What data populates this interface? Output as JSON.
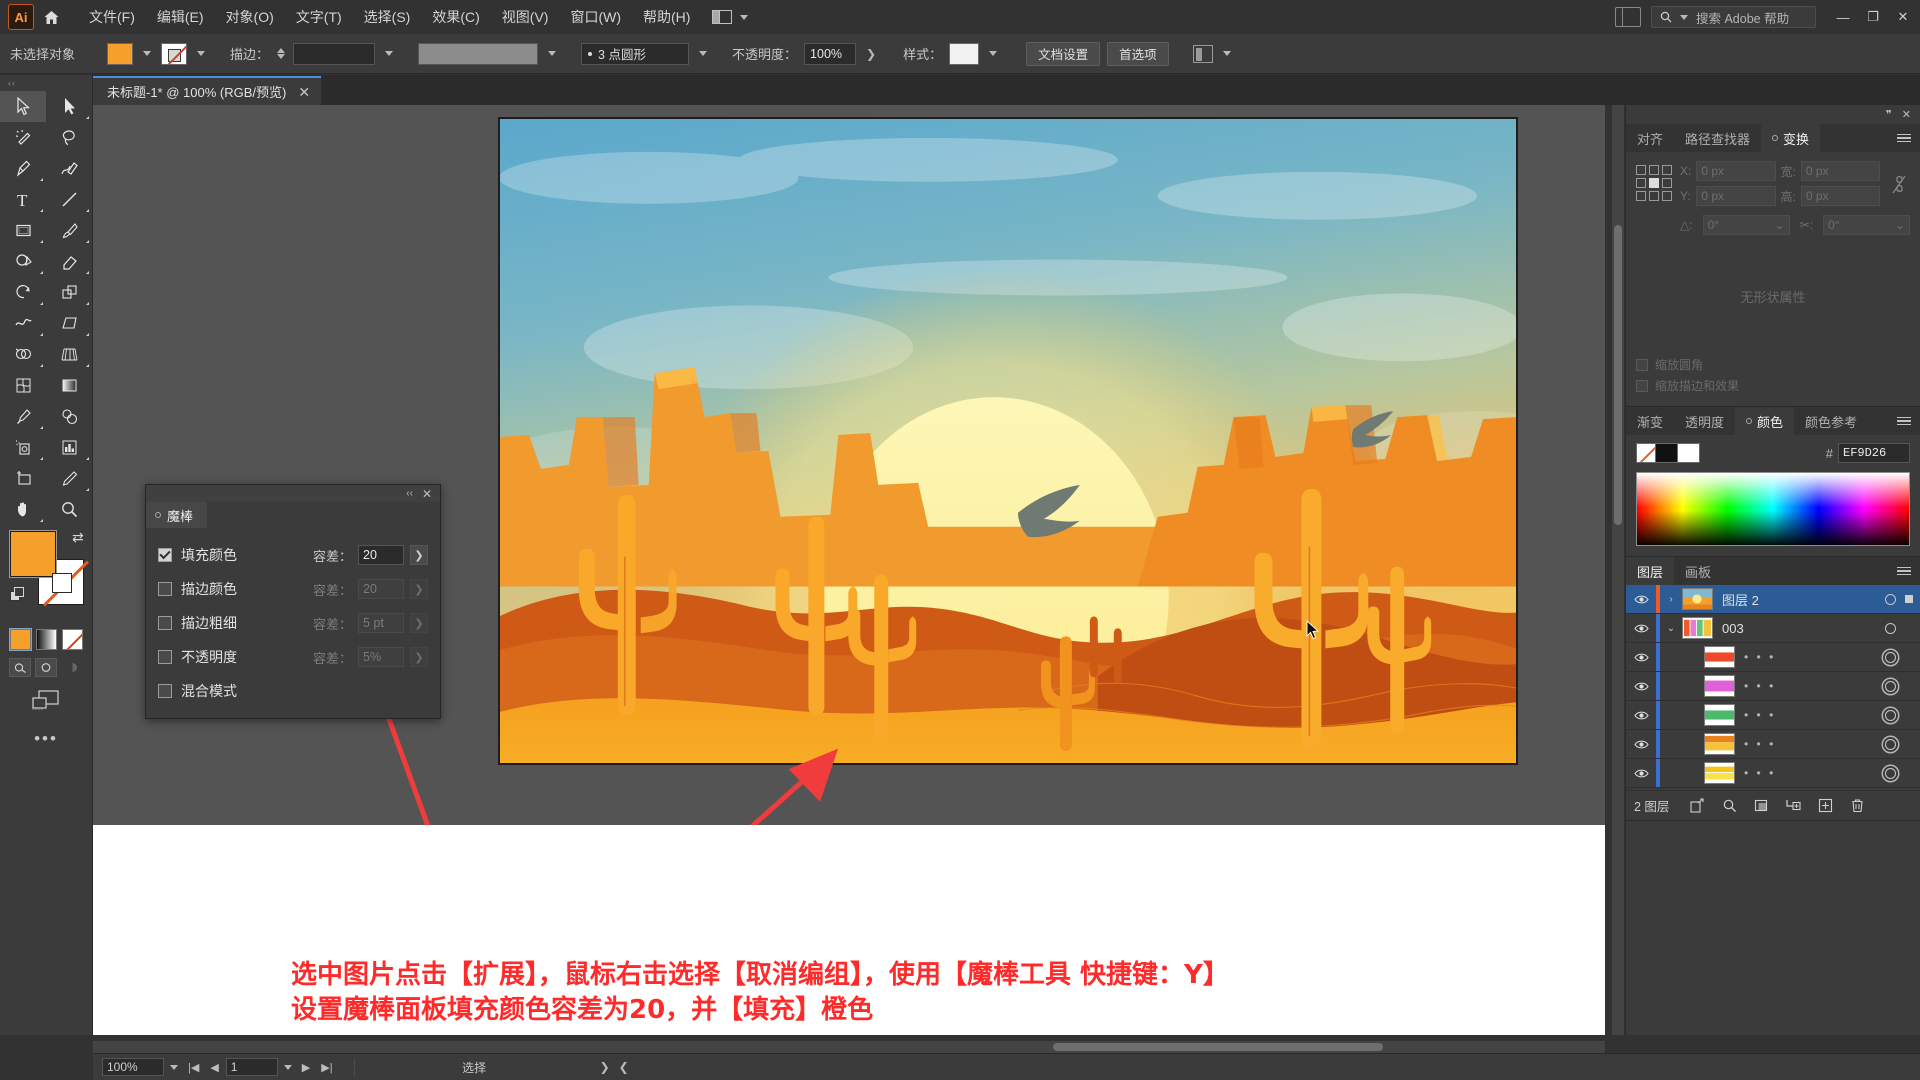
{
  "app": {
    "name": "Adobe Illustrator",
    "logo_text": "Ai"
  },
  "menubar": {
    "home_icon": "home-icon",
    "items": [
      {
        "label": "文件(F)"
      },
      {
        "label": "编辑(E)"
      },
      {
        "label": "对象(O)"
      },
      {
        "label": "文字(T)"
      },
      {
        "label": "选择(S)"
      },
      {
        "label": "效果(C)"
      },
      {
        "label": "视图(V)"
      },
      {
        "label": "窗口(W)"
      },
      {
        "label": "帮助(H)"
      }
    ],
    "search_placeholder": "搜索 Adobe 帮助",
    "minimize": "—",
    "maximize": "❐",
    "close": "✕"
  },
  "controlbar": {
    "selection_status": "未选择对象",
    "fill_swatch_color": "#F5A02A",
    "stroke_label": "描边：",
    "stroke_weight": "",
    "brush_profile": "3 点圆形",
    "opacity_label": "不透明度：",
    "opacity_value": "100%",
    "style_label": "样式：",
    "doc_setup_button": "文档设置",
    "preferences_button": "首选项"
  },
  "document_tab": {
    "title": "未标题-1* @ 100% (RGB/预览)",
    "close": "✕"
  },
  "toolbar": {
    "tools": [
      {
        "name": "selection-tool",
        "active": true
      },
      {
        "name": "direct-selection-tool",
        "active": false
      },
      {
        "name": "magic-wand-tool",
        "active": false
      },
      {
        "name": "lasso-tool",
        "active": false
      },
      {
        "name": "pen-tool",
        "active": false
      },
      {
        "name": "curvature-tool",
        "active": false
      },
      {
        "name": "type-tool",
        "active": false
      },
      {
        "name": "line-segment-tool",
        "active": false
      },
      {
        "name": "rectangle-tool",
        "active": false
      },
      {
        "name": "paintbrush-tool",
        "active": false
      },
      {
        "name": "shaper-tool",
        "active": false
      },
      {
        "name": "eraser-tool",
        "active": false
      },
      {
        "name": "rotate-tool",
        "active": false
      },
      {
        "name": "scale-tool",
        "active": false
      },
      {
        "name": "width-tool",
        "active": false
      },
      {
        "name": "free-transform-tool",
        "active": false
      },
      {
        "name": "shape-builder-tool",
        "active": false
      },
      {
        "name": "perspective-grid-tool",
        "active": false
      },
      {
        "name": "mesh-tool",
        "active": false
      },
      {
        "name": "gradient-tool",
        "active": false
      },
      {
        "name": "eyedropper-tool",
        "active": false
      },
      {
        "name": "blend-tool",
        "active": false
      },
      {
        "name": "symbol-sprayer-tool",
        "active": false
      },
      {
        "name": "column-graph-tool",
        "active": false
      },
      {
        "name": "artboard-tool",
        "active": false
      },
      {
        "name": "slice-tool",
        "active": false
      },
      {
        "name": "hand-tool",
        "active": false
      },
      {
        "name": "zoom-tool",
        "active": false
      }
    ],
    "fill_color": "#F5A02A",
    "stroke_color": "none",
    "more_tools": "•••"
  },
  "magic_wand_panel": {
    "tab_label": "魔棒",
    "collapse": "‹‹",
    "close": "✕",
    "tolerance_label": "容差：",
    "rows": [
      {
        "label": "填充颜色",
        "checked": true,
        "tolerance": "20",
        "enabled": true
      },
      {
        "label": "描边颜色",
        "checked": false,
        "tolerance": "20",
        "enabled": false
      },
      {
        "label": "描边粗细",
        "checked": false,
        "tolerance": "5 pt",
        "enabled": false
      },
      {
        "label": "不透明度",
        "checked": false,
        "tolerance": "5%",
        "enabled": false
      },
      {
        "label": "混合模式",
        "checked": false,
        "tolerance": "",
        "enabled": false
      }
    ]
  },
  "transform_panel": {
    "tabs": [
      {
        "label": "对齐",
        "selected": false
      },
      {
        "label": "路径查找器",
        "selected": false
      },
      {
        "label": "变换",
        "selected": true
      }
    ],
    "x_label": "X:",
    "x_value": "0 px",
    "y_label": "Y:",
    "y_value": "0 px",
    "w_label": "宽:",
    "w_value": "0 px",
    "h_label": "高:",
    "h_value": "0 px",
    "angle_label": "△:",
    "angle_value": "0°",
    "shear_label": "✂:",
    "shear_value": "0°",
    "options": [
      {
        "label": "缩放圆角"
      },
      {
        "label": "缩放描边和效果"
      }
    ],
    "no_appearance": "无形状属性"
  },
  "color_panel": {
    "tabs": [
      {
        "label": "渐变",
        "selected": false
      },
      {
        "label": "透明度",
        "selected": false
      },
      {
        "label": "颜色",
        "selected": true
      },
      {
        "label": "颜色参考",
        "selected": false
      }
    ],
    "hash": "#",
    "hex_value": "EF9D26",
    "swatch_none": "none-swatch",
    "swatch_black": "#000000",
    "swatch_white": "#FFFFFF"
  },
  "layers_panel": {
    "tabs": [
      {
        "label": "图层",
        "selected": true
      },
      {
        "label": "画板",
        "selected": false
      }
    ],
    "rows": [
      {
        "name": "图层 2",
        "selected": true,
        "indent": 0,
        "color": "#f05a28",
        "twisty": "›",
        "thumb": "sunset",
        "dots": "",
        "targeted": false
      },
      {
        "name": "003",
        "selected": false,
        "indent": 1,
        "color": "#3b6fd4",
        "twisty": "⌄",
        "thumb": "multi",
        "dots": "",
        "targeted": false
      },
      {
        "name": "",
        "selected": false,
        "indent": 2,
        "color": "#3b6fd4",
        "twisty": "",
        "thumb": "red",
        "dots": "• • •",
        "targeted": true
      },
      {
        "name": "",
        "selected": false,
        "indent": 2,
        "color": "#3b6fd4",
        "twisty": "",
        "thumb": "magenta",
        "dots": "• • •",
        "targeted": true
      },
      {
        "name": "",
        "selected": false,
        "indent": 2,
        "color": "#3b6fd4",
        "twisty": "",
        "thumb": "green",
        "dots": "• • •",
        "targeted": true
      },
      {
        "name": "",
        "selected": false,
        "indent": 2,
        "color": "#3b6fd4",
        "twisty": "",
        "thumb": "orange",
        "dots": "• • •",
        "targeted": true
      },
      {
        "name": "",
        "selected": false,
        "indent": 2,
        "color": "#3b6fd4",
        "twisty": "",
        "thumb": "yellow",
        "dots": "• • •",
        "targeted": true
      }
    ],
    "footer_count": "2 图层",
    "footer_icons": [
      "release-to-layers-icon",
      "locate-object-icon",
      "make-clipping-mask-icon",
      "create-sublayer-icon",
      "new-layer-icon",
      "delete-layer-icon"
    ]
  },
  "canvas": {
    "artwork_title": "desert-sunset-illustration",
    "annotation_line1": "选中图片点击【扩展】，鼠标右击选择【取消编组】，使用【魔棒工具 快捷键：Y】",
    "annotation_line2": "设置魔棒面板填充颜色容差为20，并【填充】橙色",
    "annotation_color": "#FF2A2A",
    "arrow_color": "#F03C3C"
  },
  "statusbar": {
    "zoom": "100%",
    "page": "1",
    "tool_status": "选择",
    "first": "|◀",
    "prev": "◀",
    "next": "▶",
    "last": "▶|"
  }
}
